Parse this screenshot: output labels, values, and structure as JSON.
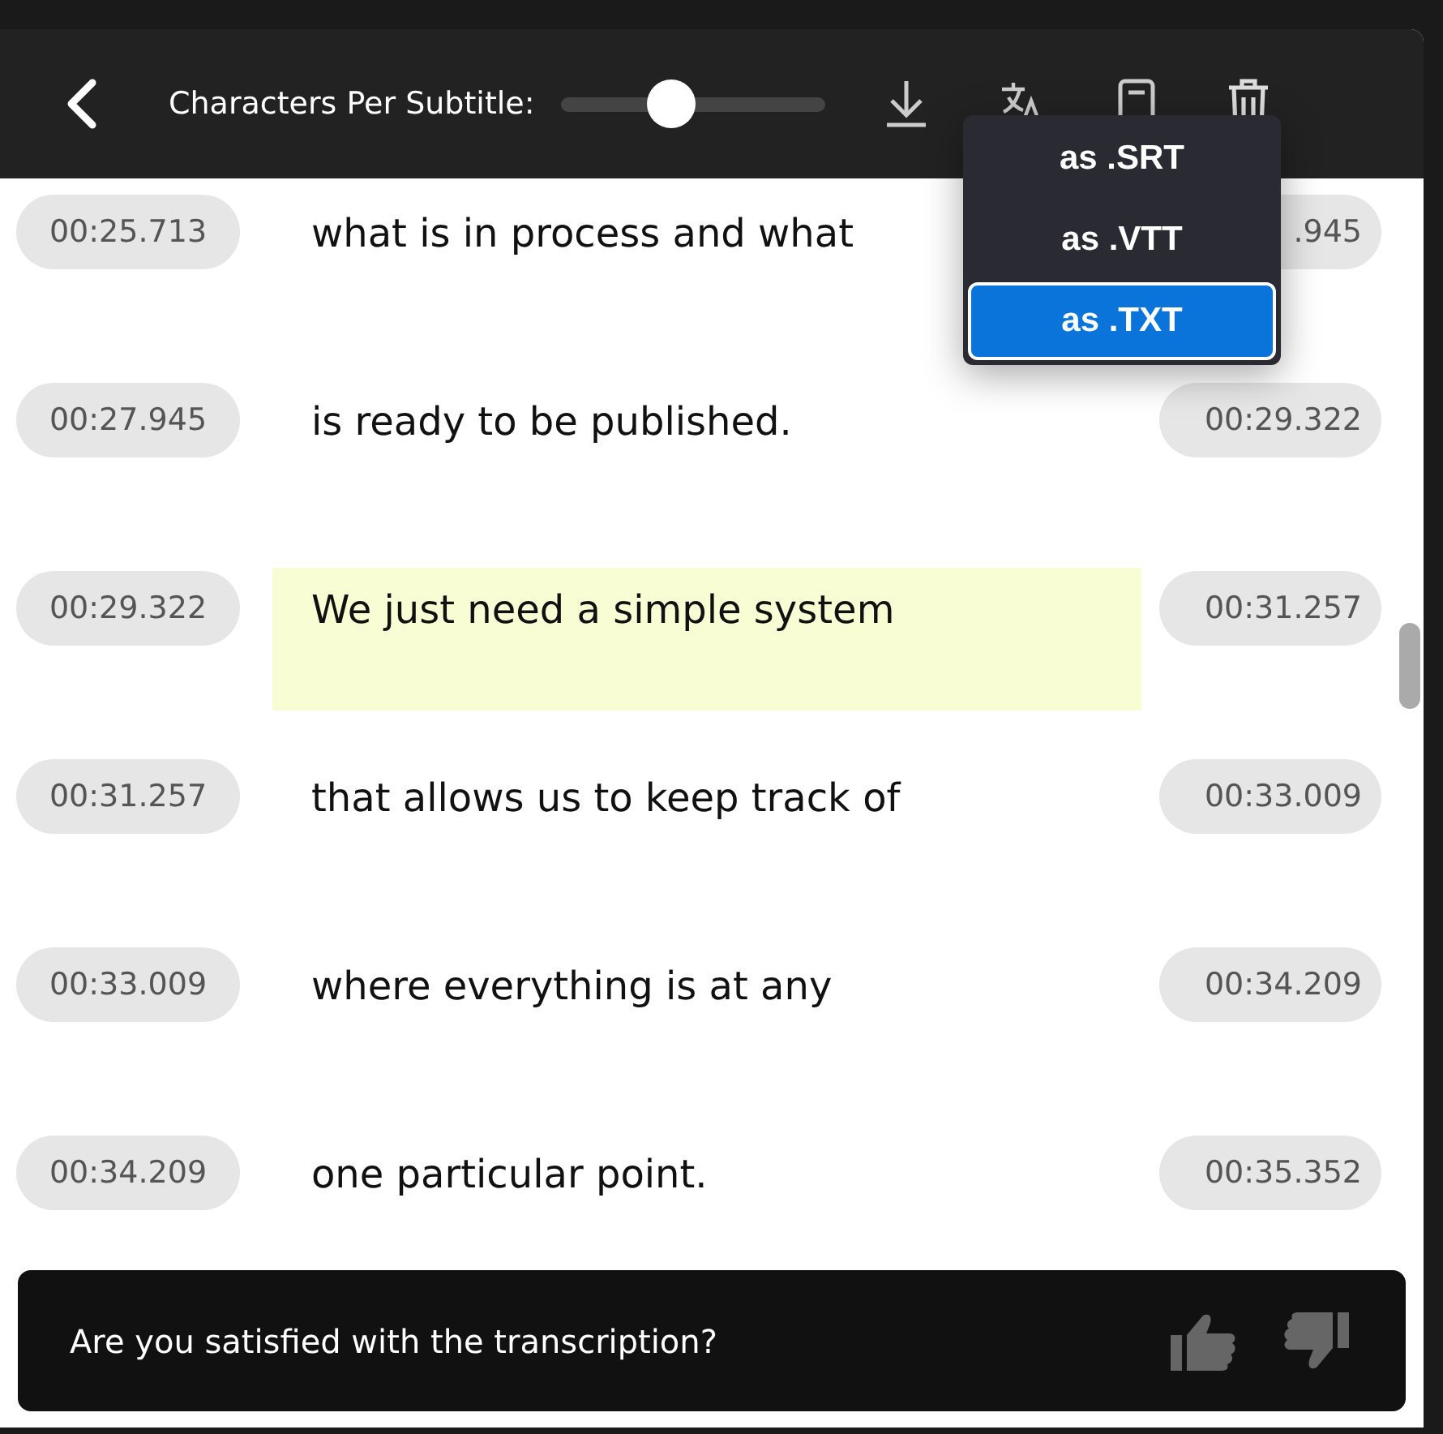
{
  "toolbar": {
    "slider_label": "Characters Per Subtitle:",
    "level": 0.42
  },
  "export_menu": [
    {
      "label": "as .SRT",
      "selected": false
    },
    {
      "label": "as .VTT",
      "selected": false
    },
    {
      "label": "as .TXT",
      "selected": true
    }
  ],
  "subtitles": [
    {
      "start": "00:25.713",
      "text": "what is in process and what",
      "end": ".945",
      "selected": false
    },
    {
      "start": "00:27.945",
      "text": "is ready to be published.",
      "end": "00:29.322",
      "selected": false
    },
    {
      "start": "00:29.322",
      "text": "We just need a simple system",
      "end": "00:31.257",
      "selected": true
    },
    {
      "start": "00:31.257",
      "text": "that allows us to keep track of",
      "end": "00:33.009",
      "selected": false
    },
    {
      "start": "00:33.009",
      "text": "where everything is at any",
      "end": "00:34.209",
      "selected": false
    },
    {
      "start": "00:34.209",
      "text": "one particular point.",
      "end": "00:35.352",
      "selected": false
    }
  ],
  "feedback": {
    "question": "Are you satisfied with the transcription?"
  }
}
